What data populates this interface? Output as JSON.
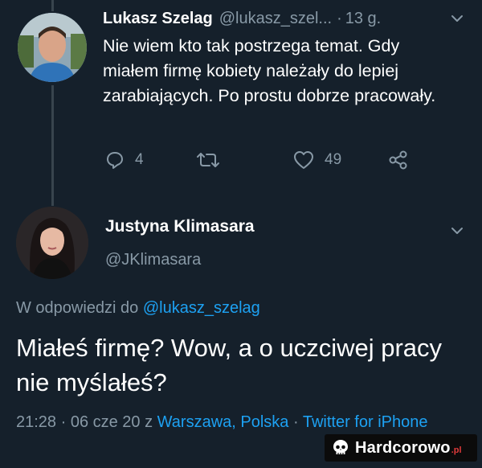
{
  "tweet1": {
    "name": "Lukasz Szelag",
    "handle": "@lukasz_szel...",
    "separator": "·",
    "time": "13 g.",
    "text": "Nie wiem kto tak postrzega temat. Gdy miałem firmę kobiety należały do lepiej zarabiających. Po prostu dobrze pracowały.",
    "actions": {
      "reply_count": "4",
      "like_count": "49"
    }
  },
  "tweet2": {
    "name": "Justyna Klimasara",
    "handle": "@JKlimasara",
    "reply_prefix": "W odpowiedzi do ",
    "reply_to": "@lukasz_szelag",
    "text": "Miałeś firmę? Wow, a o uczciwej pracy nie myślałeś?",
    "timestamp": "21:28 · 06 cze 20 z ",
    "location": "Warszawa, Polska",
    "meta_sep": " · ",
    "source": "Twitter for iPhone"
  },
  "watermark": {
    "text": "Hardcorowo",
    "tld": ".pl"
  },
  "colors": {
    "background": "#15202b",
    "secondary_text": "#8899a6",
    "link": "#1da1f2"
  }
}
